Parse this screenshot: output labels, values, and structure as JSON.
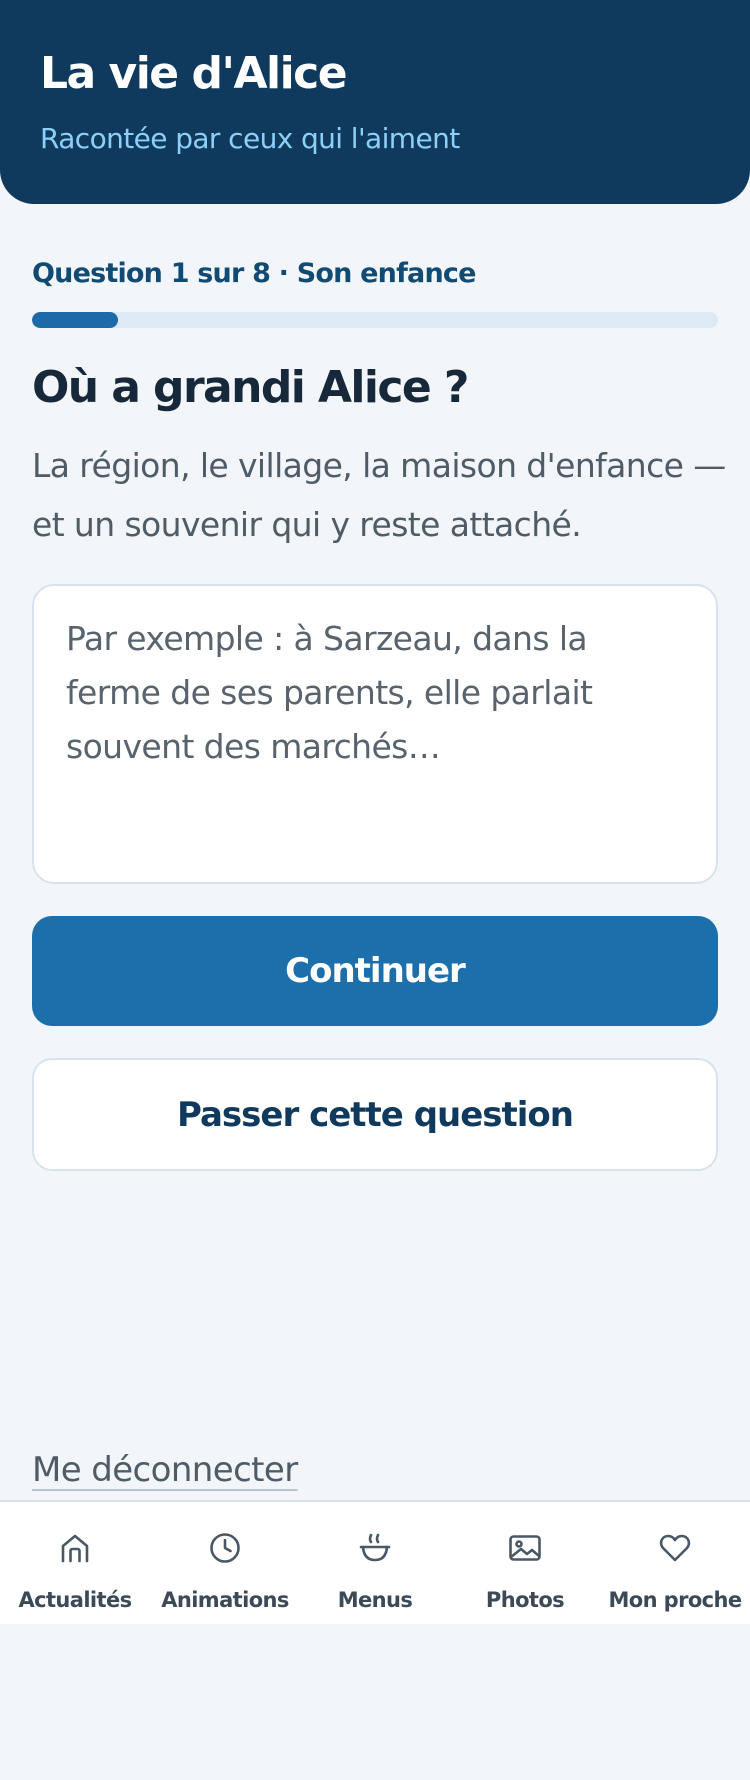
{
  "header": {
    "title": "La vie d'Alice",
    "subtitle": "Racontée par ceux qui l'aiment"
  },
  "progress": {
    "label": "Question 1 sur 8 · Son enfance",
    "current": 1,
    "total": 8,
    "fraction": 0.125
  },
  "question": {
    "title": "Où a grandi Alice ?",
    "hint": "La région, le village, la maison d'enfance — et un souvenir qui y reste attaché.",
    "answer_value": "",
    "answer_placeholder": "Par exemple : à Sarzeau, dans la ferme de ses parents, elle parlait souvent des marchés…"
  },
  "actions": {
    "continue_label": "Continuer",
    "skip_label": "Passer cette question"
  },
  "logout_label": "Me déconnecter",
  "nav": {
    "items": [
      {
        "label": "Actualités",
        "icon": "home-icon"
      },
      {
        "label": "Animations",
        "icon": "clock-icon"
      },
      {
        "label": "Menus",
        "icon": "bowl-icon"
      },
      {
        "label": "Photos",
        "icon": "image-icon"
      },
      {
        "label": "Mon proche",
        "icon": "heart-icon"
      }
    ]
  },
  "colors": {
    "header_bg": "#0f3a5e",
    "accent": "#1d6fab",
    "subtitle": "#8dd0f7",
    "background": "#f2f6fa"
  }
}
